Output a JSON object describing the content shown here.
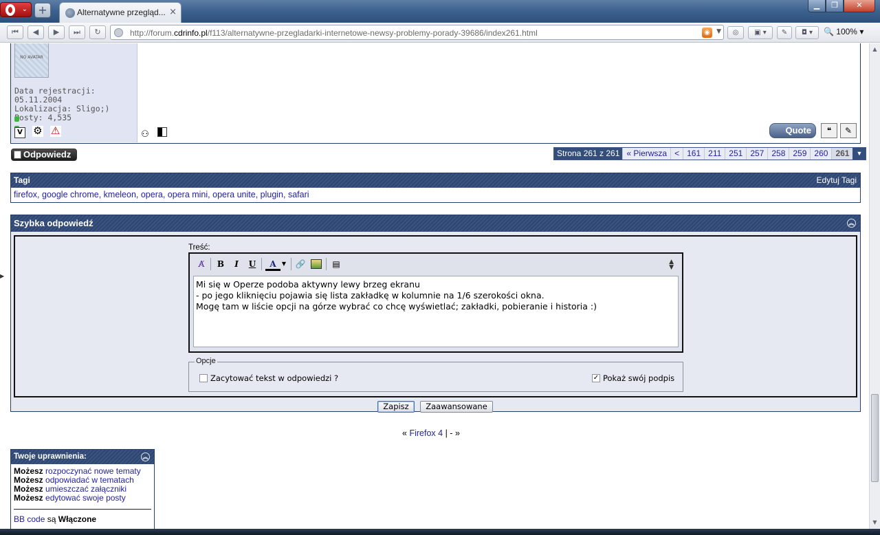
{
  "browser": {
    "tab_title": "Alternatywne przegląd...",
    "url_prefix": "http://forum.",
    "url_domain": "cdrinfo.pl",
    "url_path": "/f113/alternatywne-przegladarki-internetowe-newsy-problemy-porady-39686/index261.html",
    "zoom": "100%",
    "close_glyph": "×",
    "new_tab_glyph": "+"
  },
  "post": {
    "avatar_text": "NO AVATAR",
    "registration": "Data rejestracji: 05.11.2004",
    "location": "Lokalizacja: Sligo;)",
    "posts": "Posty: 4,535",
    "quote_label": "Quote"
  },
  "reply_button": "Odpowiedz",
  "pagination": {
    "label": "Strona 261 z 261",
    "first": "« Pierwsza",
    "prev": "<",
    "pages": [
      "161",
      "211",
      "251",
      "257",
      "258",
      "259",
      "260"
    ],
    "current": "261"
  },
  "tags": {
    "title": "Tagi",
    "edit": "Edytuj Tagi",
    "items": [
      "firefox",
      "google chrome",
      "kmeleon",
      "opera",
      "opera mini",
      "opera unite",
      "plugin",
      "safari"
    ]
  },
  "quick_reply": {
    "title": "Szybka odpowiedź",
    "content_label": "Treść:",
    "text_lines": [
      "Mi się w Operze podoba aktywny lewy brzeg ekranu",
      "- po jego kliknięciu pojawia się lista zakładkę w kolumnie na 1/6 szerokości okna.",
      "Mogę tam w liście opcji na górze wybrać co chcę wyświetlać; zakładki, pobieranie i historia :)"
    ],
    "options_legend": "Opcje",
    "quote_option": "Zacytować tekst w odpowiedzi ?",
    "signature_option": "Pokaż swój podpis",
    "save_button": "Zapisz",
    "advanced_button": "Zaawansowane"
  },
  "thread_nav": {
    "prev_glyph": "«",
    "prev_link": "Firefox 4",
    "sep": "| -",
    "next_glyph": "»"
  },
  "permissions": {
    "title": "Twoje uprawnienia:",
    "rows": [
      {
        "bold": "Możesz",
        "text": "rozpoczynać nowe tematy"
      },
      {
        "bold": "Możesz",
        "text": "odpowiadać w tematach"
      },
      {
        "bold": "Możesz",
        "text": "umieszczać załączniki"
      },
      {
        "bold": "Możesz",
        "text": "edytować swoje posty"
      }
    ],
    "bbcode_link": "BB code",
    "bbcode_text": "są",
    "bbcode_state": "Włączone"
  },
  "colors": {
    "header_blue": "#2f466e",
    "link_blue": "#22229c",
    "panel_bg": "#e6e9f2"
  }
}
